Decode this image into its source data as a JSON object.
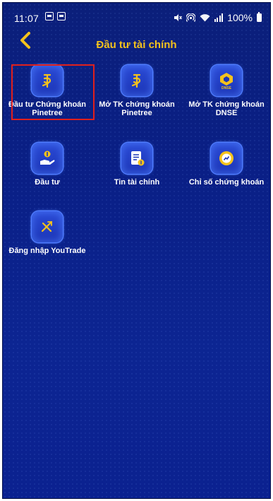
{
  "status_bar": {
    "time": "11:07",
    "battery": "100%",
    "icons": [
      "photo-icon",
      "notification-icon",
      "mute-icon",
      "hotspot-icon",
      "wifi-icon",
      "signal-icon",
      "battery-icon"
    ]
  },
  "header": {
    "title": "Đầu tư tài chính",
    "back_icon": "chevron-left-icon"
  },
  "colors": {
    "accent": "#f4c21c",
    "background": "#0a1f86",
    "tile": "#1c35b6",
    "selection": "#e0201c"
  },
  "menu": {
    "items": [
      {
        "line1": "Đầu tư Chứng khoán",
        "line2": "Pinetree",
        "icon": "pinetree-logo-icon",
        "selected": true
      },
      {
        "line1": "Mở TK chứng khoán",
        "line2": "Pinetree",
        "icon": "pinetree-logo-icon",
        "selected": false
      },
      {
        "line1": "Mở TK chứng khoán",
        "line2": "DNSE",
        "icon": "dnse-logo-icon",
        "selected": false
      },
      {
        "line1": "Đầu tư",
        "line2": "",
        "icon": "invest-money-hand-icon",
        "selected": false
      },
      {
        "line1": "Tin tài chính",
        "line2": "",
        "icon": "financial-news-icon",
        "selected": false
      },
      {
        "line1": "Chỉ số chứng khoán",
        "line2": "",
        "icon": "stock-index-icon",
        "selected": false
      },
      {
        "line1": "Đăng nhập YouTrade",
        "line2": "",
        "icon": "youtrade-logo-icon",
        "selected": false
      }
    ]
  },
  "icon_text": {
    "dnse": "DNSE"
  }
}
